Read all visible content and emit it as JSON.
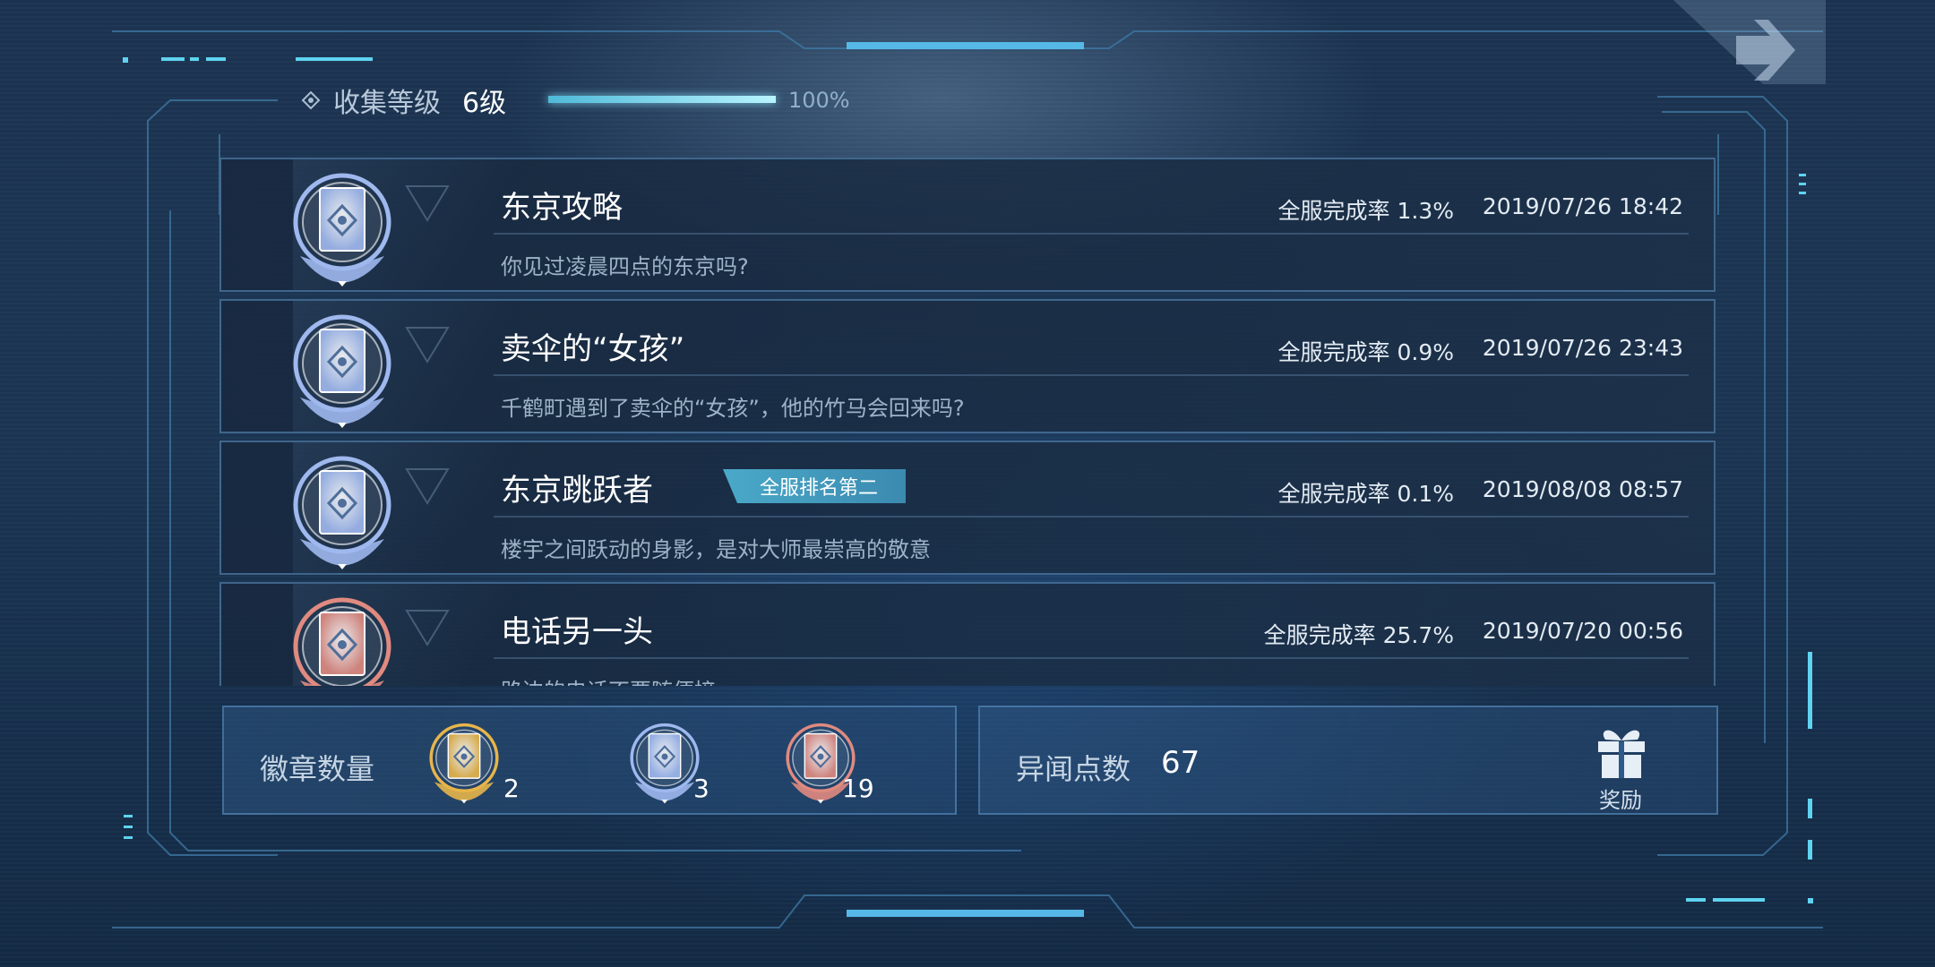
{
  "header": {
    "label": "收集等级",
    "level": "6级",
    "progress_percent": 100,
    "progress_text": "100%"
  },
  "achievements": [
    {
      "title": "东京攻略",
      "desc": "你见过凌晨四点的东京吗?",
      "rate": "全服完成率 1.3%",
      "date": "2019/07/26 18:42",
      "tier": "silver",
      "tag": ""
    },
    {
      "title": "卖伞的“女孩”",
      "desc": "千鹤町遇到了卖伞的“女孩”，他的竹马会回来吗?",
      "rate": "全服完成率 0.9%",
      "date": "2019/07/26 23:43",
      "tier": "silver",
      "tag": ""
    },
    {
      "title": "东京跳跃者",
      "desc": "楼宇之间跃动的身影，是对大师最崇高的敬意",
      "rate": "全服完成率 0.1%",
      "date": "2019/08/08 08:57",
      "tier": "silver",
      "tag": "全服排名第二"
    },
    {
      "title": "电话另一头",
      "desc": "路边的电话不要随便接",
      "rate": "全服完成率 25.7%",
      "date": "2019/07/20 00:56",
      "tier": "bronze",
      "tag": ""
    }
  ],
  "badges": {
    "label": "徽章数量",
    "gold": "2",
    "silver": "3",
    "bronze": "19"
  },
  "points": {
    "label": "异闻点数",
    "value": "67",
    "reward_label": "奖励"
  },
  "colors": {
    "accent": "#5fd3f0",
    "silver": "#9fb8ee",
    "gold": "#e7b54a",
    "bronze": "#e08a80"
  },
  "icons": {
    "back": "arrow-right-icon",
    "header": "diamond-icon",
    "reward": "gift-icon"
  }
}
